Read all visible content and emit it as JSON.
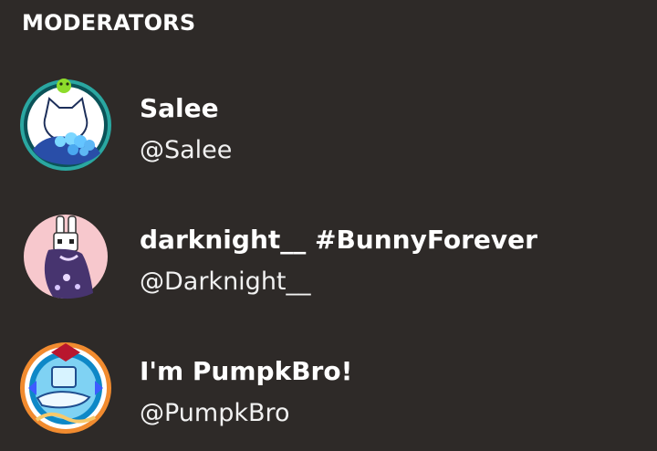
{
  "section": {
    "title": "MODERATORS"
  },
  "moderators": [
    {
      "display_name": "Salee",
      "handle": "@Salee",
      "avatar_icon": "white-cat-avatar-icon"
    },
    {
      "display_name": "darknight__ #BunnyForever",
      "handle": "@Darknight__",
      "avatar_icon": "bunny-avatar-icon"
    },
    {
      "display_name": "I'm PumpkBro!",
      "handle": "@PumpkBro",
      "avatar_icon": "airship-badge-avatar-icon"
    }
  ]
}
